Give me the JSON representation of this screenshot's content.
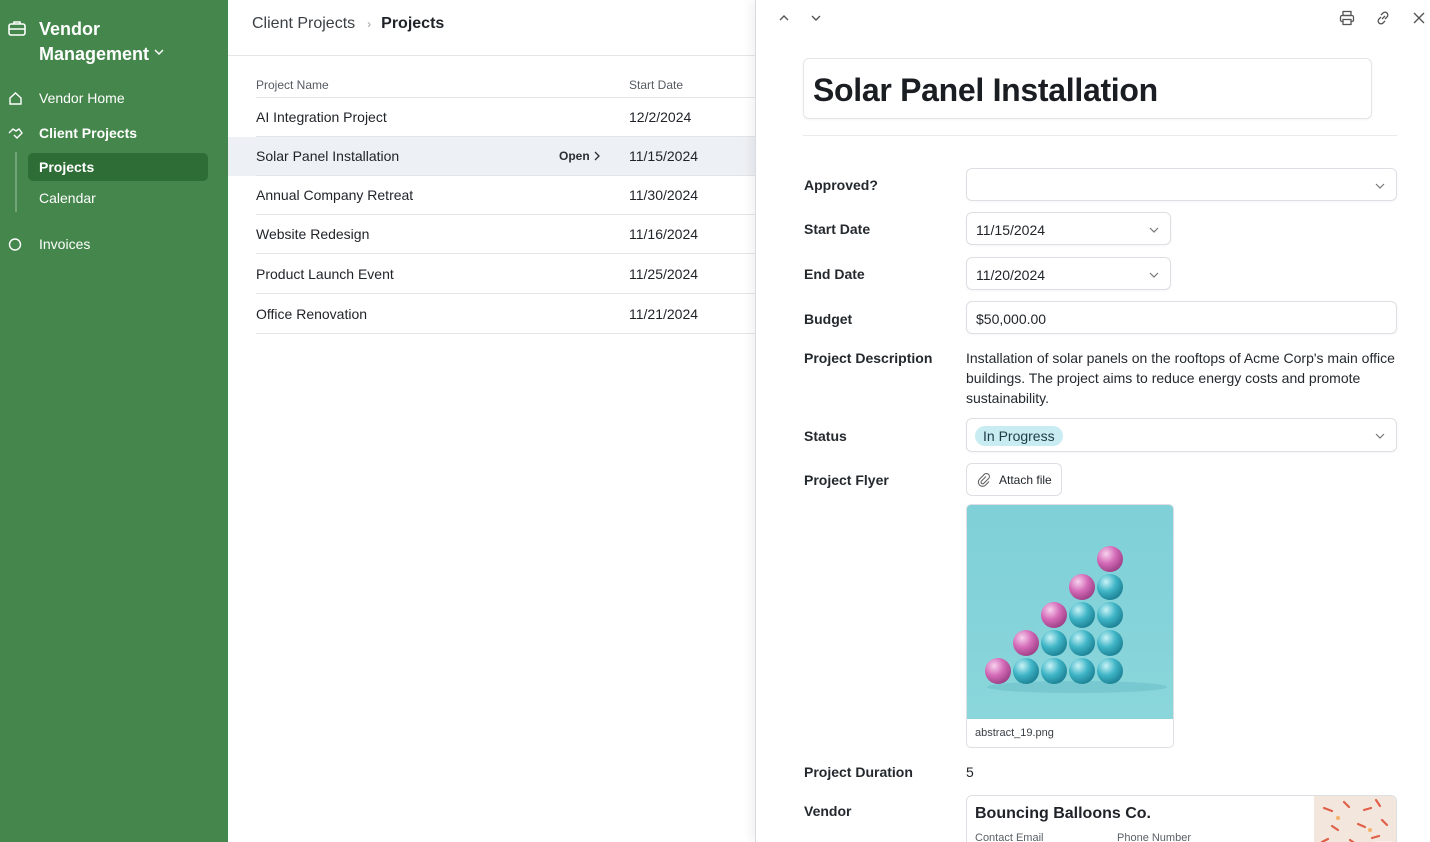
{
  "app": {
    "title": "Vendor Management"
  },
  "sidebar": {
    "items": [
      {
        "label": "Vendor Home",
        "icon": "home-icon"
      },
      {
        "label": "Client Projects",
        "icon": "handshake-icon"
      },
      {
        "label": "Invoices",
        "icon": "circle-icon"
      }
    ],
    "subitems": [
      {
        "label": "Projects",
        "active": true
      },
      {
        "label": "Calendar",
        "active": false
      }
    ],
    "colors": {
      "background": "#44864b",
      "active": "#2e6d35"
    }
  },
  "list": {
    "breadcrumb": {
      "parent": "Client Projects",
      "current": "Projects"
    },
    "columns": {
      "name": "Project Name",
      "start": "Start Date"
    },
    "open_label": "Open",
    "rows": [
      {
        "name": "AI Integration Project",
        "start": "12/2/2024"
      },
      {
        "name": "Solar Panel Installation",
        "start": "11/15/2024",
        "selected": true
      },
      {
        "name": "Annual Company Retreat",
        "start": "11/30/2024"
      },
      {
        "name": "Website Redesign",
        "start": "11/16/2024"
      },
      {
        "name": "Product Launch Event",
        "start": "11/25/2024"
      },
      {
        "name": "Office Renovation",
        "start": "11/21/2024"
      }
    ]
  },
  "detail": {
    "title": "Solar Panel Installation",
    "toolbar_icons": [
      "chevron-up-icon",
      "chevron-down-icon",
      "print-icon",
      "link-icon",
      "close-icon"
    ],
    "labels": {
      "approved": "Approved?",
      "start": "Start Date",
      "end": "End Date",
      "budget": "Budget",
      "description": "Project Description",
      "status": "Status",
      "flyer": "Project Flyer",
      "duration": "Project Duration",
      "vendor": "Vendor"
    },
    "values": {
      "approved": "",
      "start": "11/15/2024",
      "end": "11/20/2024",
      "budget": "$50,000.00",
      "description": "Installation of solar panels on the rooftops of Acme Corp's main office buildings. The project aims to reduce energy costs and promote sustainability.",
      "status": "In Progress",
      "attach_label": "Attach file",
      "flyer_filename": "abstract_19.png",
      "duration": "5"
    },
    "vendor": {
      "name": "Bouncing Balloons Co.",
      "contact_label": "Contact Email",
      "phone_label": "Phone Number"
    },
    "status_color": "#c8ecf2"
  }
}
